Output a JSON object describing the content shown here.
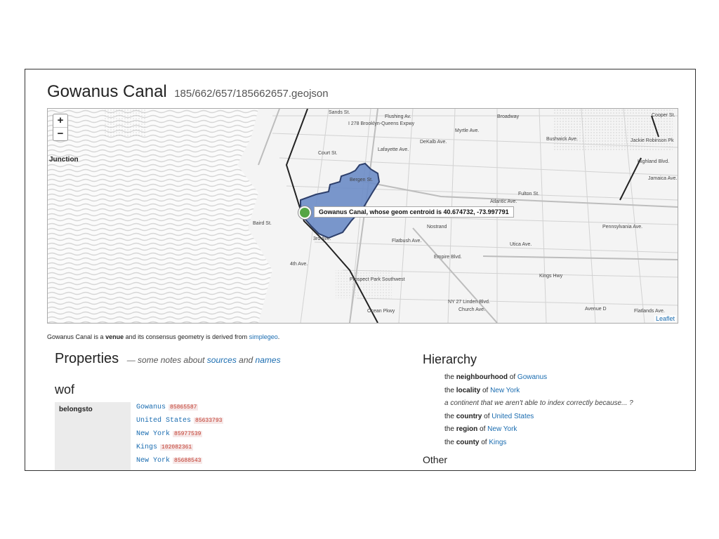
{
  "page": {
    "title": "Gowanus Canal",
    "path": "185/662/657/185662657.geojson"
  },
  "map": {
    "zoom_in": "+",
    "zoom_out": "−",
    "tooltip": "Gowanus Canal, whose geom centroid is 40.674732, -73.997791",
    "attribution": "Leaflet",
    "junction_label": "Junction",
    "streets": [
      "Sands St.",
      "Flushing Av.",
      "Myrtle Ave.",
      "DeKalb Ave.",
      "Lafayette Ave.",
      "Fulton St.",
      "Atlantic Ave.",
      "Bushwick Ave.",
      "Broadway",
      "Empire Blvd.",
      "NY 27 Linden Blvd.",
      "Church Ave.",
      "Ocean Pkwy",
      "Prospect Park Southwest",
      "Bergen St.",
      "3rd Ave.",
      "4th Ave.",
      "Jackie Robinson Pk",
      "Highland Blvd.",
      "Jamaica Ave.",
      "Pennsylvania Ave.",
      "Kings Hwy",
      "Utica Ave.",
      "Nostrand",
      "Flatbush Ave.",
      "Avenue D",
      "Flatlands Ave.",
      "Cooper St.",
      "Court St.",
      "Baird St.",
      "I 278 Brooklyn-Queens Expwy"
    ],
    "colors": {
      "polygon_fill": "#6b8cc7",
      "polygon_stroke": "#2d3f6b",
      "marker": "#55a544",
      "water_stripe": "#d6d6d6",
      "roads": "#cfcfcf"
    }
  },
  "summary": {
    "prefix": "Gowanus Canal is a",
    "placetype": "venue",
    "middle": "and its consensus geometry is derived from",
    "source": "simplegeo",
    "end": "."
  },
  "properties": {
    "heading": "Properties",
    "note_prefix": "— some notes about",
    "sources_link": "sources",
    "and": "and",
    "names_link": "names"
  },
  "wof": {
    "heading": "wof",
    "belongsto_label": "belongsto",
    "belongsto": [
      {
        "name": "Gowanus",
        "id": "85865587"
      },
      {
        "name": "United States",
        "id": "85633793"
      },
      {
        "name": "New York",
        "id": "85977539"
      },
      {
        "name": "Kings",
        "id": "102082361"
      },
      {
        "name": "New York",
        "id": "85688543"
      }
    ]
  },
  "hierarchy": {
    "heading": "Hierarchy",
    "items": [
      {
        "the": "the",
        "type": "neighbourhood",
        "of": "of",
        "name": "Gowanus"
      },
      {
        "the": "the",
        "type": "locality",
        "of": "of",
        "name": "New York"
      },
      {
        "note": "a continent that we aren't able to index correctly because... ?"
      },
      {
        "the": "the",
        "type": "country",
        "of": "of",
        "name": "United States"
      },
      {
        "the": "the",
        "type": "region",
        "of": "of",
        "name": "New York"
      },
      {
        "the": "the",
        "type": "county",
        "of": "of",
        "name": "Kings"
      }
    ],
    "other_heading": "Other"
  }
}
